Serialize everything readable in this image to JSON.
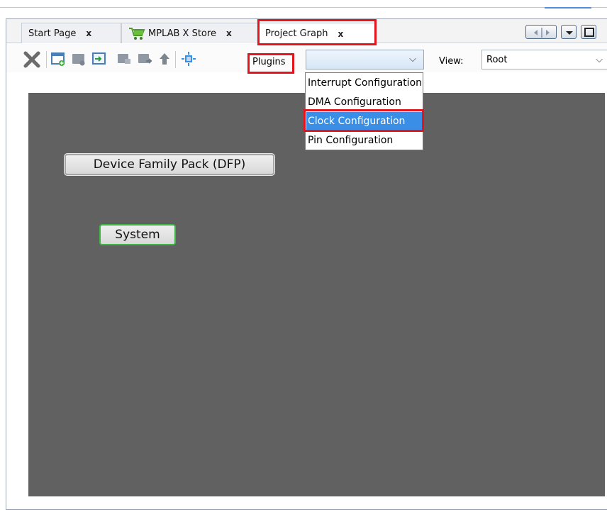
{
  "tabs": [
    {
      "label": "Start Page",
      "close": "x"
    },
    {
      "label": "MPLAB X Store",
      "close": "x"
    },
    {
      "label": "Project Graph",
      "close": "x"
    }
  ],
  "toolbar": {
    "plugins_label": "Plugins",
    "plugins_combo_value": "",
    "view_label": "View:",
    "view_value": "Root",
    "chevron": "⌵"
  },
  "plugins_dropdown": {
    "items": [
      "Interrupt Configuration",
      "DMA Configuration",
      "Clock Configuration",
      "Pin Configuration"
    ],
    "selected": "Clock Configuration"
  },
  "graph": {
    "nodes": [
      {
        "label": "Device Family Pack (DFP)"
      },
      {
        "label": "System"
      }
    ]
  },
  "colors": {
    "canvas": "#616161",
    "highlight": "#e3141c",
    "selection": "#3a8ee6",
    "system_node_border": "#3fb543"
  },
  "icons": {
    "cart": "shopping-cart-icon",
    "delete": "delete-icon",
    "up_arrow": "up-arrow-icon",
    "fit": "fit-to-window-icon"
  }
}
